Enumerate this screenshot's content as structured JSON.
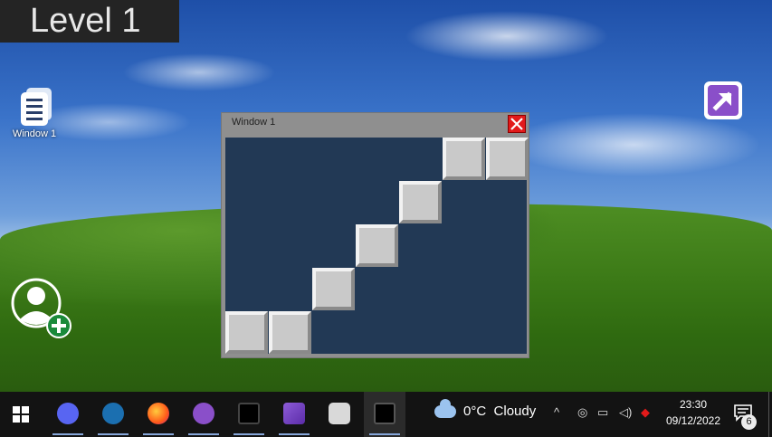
{
  "hud": {
    "level": "Level 1"
  },
  "desktop": {
    "icons": [
      {
        "label": "Window 1",
        "icon": "document-stack-icon"
      },
      {
        "icon": "add-user-icon"
      },
      {
        "icon": "exit-arrow-icon",
        "color": "#8a4fc9"
      }
    ]
  },
  "window": {
    "title": "Window 1",
    "close_color": "#e21a1a",
    "background": "#223955",
    "blocks": [
      {
        "col": 0,
        "row": 4
      },
      {
        "col": 1,
        "row": 4
      },
      {
        "col": 2,
        "row": 3
      },
      {
        "col": 3,
        "row": 2
      },
      {
        "col": 4,
        "row": 1
      },
      {
        "col": 5,
        "row": 0
      },
      {
        "col": 6,
        "row": 0
      }
    ]
  },
  "taskbar": {
    "apps": [
      {
        "name": "discord-icon",
        "color": "#5865f2"
      },
      {
        "name": "steam-icon",
        "color": "#1b6fb0"
      },
      {
        "name": "firefox-icon",
        "color": "#ff7a1a"
      },
      {
        "name": "github-icon",
        "color": "#8a4fc9"
      },
      {
        "name": "unity-icon",
        "color": "#d9d9d9"
      },
      {
        "name": "visual-studio-icon",
        "color": "#8d5cd8"
      },
      {
        "name": "unity-hub-icon",
        "color": "#d9d9d9"
      },
      {
        "name": "unity-icon",
        "color": "#d9d9d9"
      }
    ],
    "weather": {
      "temp": "0°C",
      "condition": "Cloudy"
    },
    "clock": {
      "time": "23:30",
      "date": "09/12/2022"
    },
    "notifications": "6"
  }
}
